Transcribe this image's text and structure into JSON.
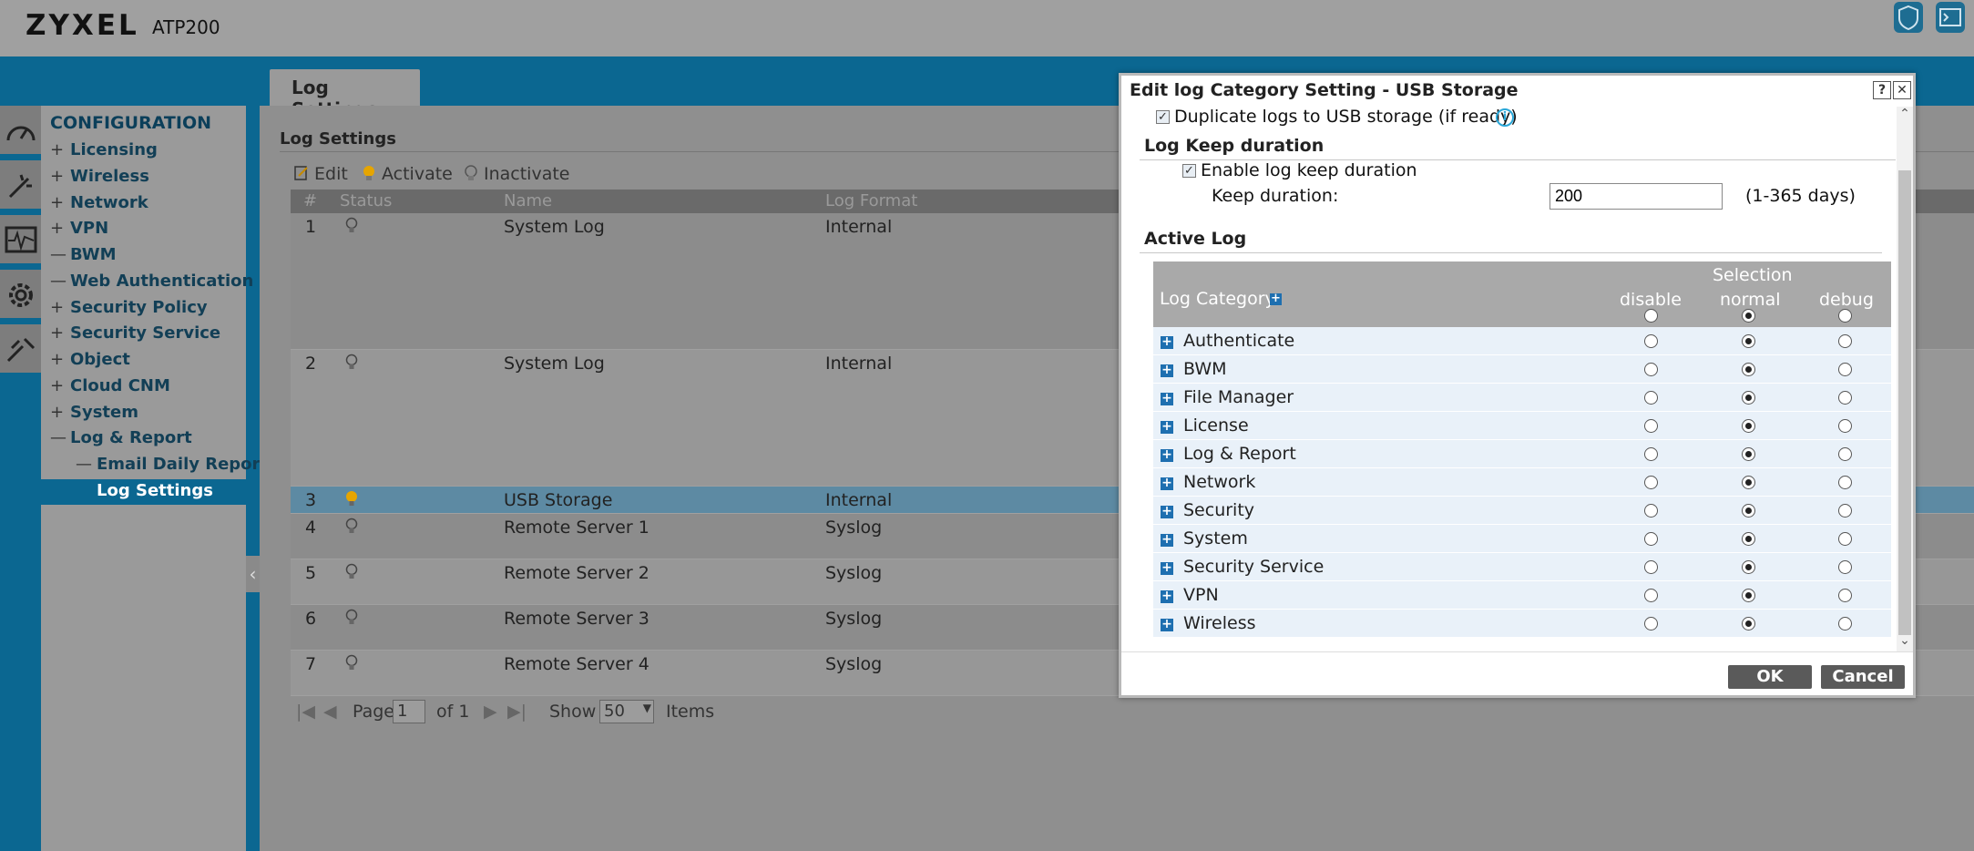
{
  "header": {
    "logo": "ZYXEL",
    "model": "ATP200"
  },
  "tab": {
    "label": "Log Settings"
  },
  "sidebar": {
    "title": "CONFIGURATION",
    "items": [
      {
        "sign": "+",
        "label": "Licensing"
      },
      {
        "sign": "+",
        "label": "Wireless"
      },
      {
        "sign": "+",
        "label": "Network"
      },
      {
        "sign": "+",
        "label": "VPN"
      },
      {
        "sign": "—",
        "label": "BWM"
      },
      {
        "sign": "—",
        "label": "Web Authentication"
      },
      {
        "sign": "+",
        "label": "Security Policy"
      },
      {
        "sign": "+",
        "label": "Security Service"
      },
      {
        "sign": "+",
        "label": "Object"
      },
      {
        "sign": "+",
        "label": "Cloud CNM"
      },
      {
        "sign": "+",
        "label": "System"
      },
      {
        "sign": "—",
        "label": "Log & Report"
      },
      {
        "sign": "—",
        "label": "Email Daily Report"
      },
      {
        "sign": "",
        "label": "Log Settings"
      }
    ]
  },
  "main": {
    "section_title": "Log Settings",
    "toolbar": {
      "edit": "Edit",
      "activate": "Activate",
      "inactivate": "Inactivate"
    },
    "columns": {
      "num": "#",
      "status": "Status",
      "name": "Name",
      "format": "Log Format"
    },
    "rows": [
      {
        "num": "1",
        "name": "System Log",
        "format": "Internal"
      },
      {
        "num": "2",
        "name": "System Log",
        "format": "Internal"
      },
      {
        "num": "3",
        "name": "USB Storage",
        "format": "Internal"
      },
      {
        "num": "4",
        "name": "Remote Server 1",
        "format": "Syslog"
      },
      {
        "num": "5",
        "name": "Remote Server 2",
        "format": "Syslog"
      },
      {
        "num": "6",
        "name": "Remote Server 3",
        "format": "Syslog"
      },
      {
        "num": "7",
        "name": "Remote Server 4",
        "format": "Syslog"
      }
    ],
    "pager": {
      "page_label": "Page",
      "page_value": "1",
      "of_label": "of 1",
      "show_label": "Show",
      "show_value": "50",
      "items_label": "Items"
    }
  },
  "dialog": {
    "title": "Edit log Category Setting - USB Storage",
    "help": "?",
    "close": "✕",
    "duplicate_label": "Duplicate logs to USB storage (if ready)",
    "keep_group": "Log Keep duration",
    "enable_keep_label": "Enable log keep duration",
    "keep_duration_label": "Keep duration:",
    "keep_duration_value": "200",
    "keep_duration_hint": "(1-365 days)",
    "active_group": "Active Log",
    "table": {
      "category_header": "Log Category",
      "selection_header": "Selection",
      "disable_header": "disable",
      "normal_header": "normal",
      "debug_header": "debug",
      "categories": [
        {
          "label": "Authenticate",
          "selected": "normal"
        },
        {
          "label": "BWM",
          "selected": "normal"
        },
        {
          "label": "File Manager",
          "selected": "normal"
        },
        {
          "label": "License",
          "selected": "normal"
        },
        {
          "label": "Log & Report",
          "selected": "normal"
        },
        {
          "label": "Network",
          "selected": "normal"
        },
        {
          "label": "Security",
          "selected": "normal"
        },
        {
          "label": "System",
          "selected": "normal"
        },
        {
          "label": "Security Service",
          "selected": "normal"
        },
        {
          "label": "VPN",
          "selected": "normal"
        },
        {
          "label": "Wireless",
          "selected": "normal"
        }
      ]
    },
    "ok_label": "OK",
    "cancel_label": "Cancel"
  }
}
